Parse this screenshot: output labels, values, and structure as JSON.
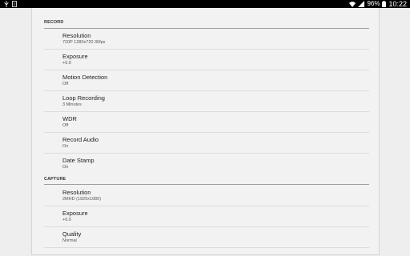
{
  "status_bar": {
    "battery_percent": "96%",
    "time": "10:22",
    "icons": [
      "usb-icon",
      "notification-icon",
      "wifi-icon",
      "signal-icon",
      "battery-icon"
    ]
  },
  "record": {
    "header": "RECORD",
    "items": [
      {
        "title": "Resolution",
        "summary": "720P 1280x720 30fps"
      },
      {
        "title": "Exposure",
        "summary": "+0.0"
      },
      {
        "title": "Motion Detection",
        "summary": "Off"
      },
      {
        "title": "Loop Recording",
        "summary": "3 Minutes"
      },
      {
        "title": "WDR",
        "summary": "Off"
      },
      {
        "title": "Record Audio",
        "summary": "On"
      },
      {
        "title": "Date Stamp",
        "summary": "On"
      }
    ]
  },
  "capture": {
    "header": "CAPTURE",
    "items": [
      {
        "title": "Resolution",
        "summary": "2MHD (1920x1080)"
      },
      {
        "title": "Exposure",
        "summary": "+0.0"
      },
      {
        "title": "Quality",
        "summary": "Normal"
      }
    ]
  }
}
